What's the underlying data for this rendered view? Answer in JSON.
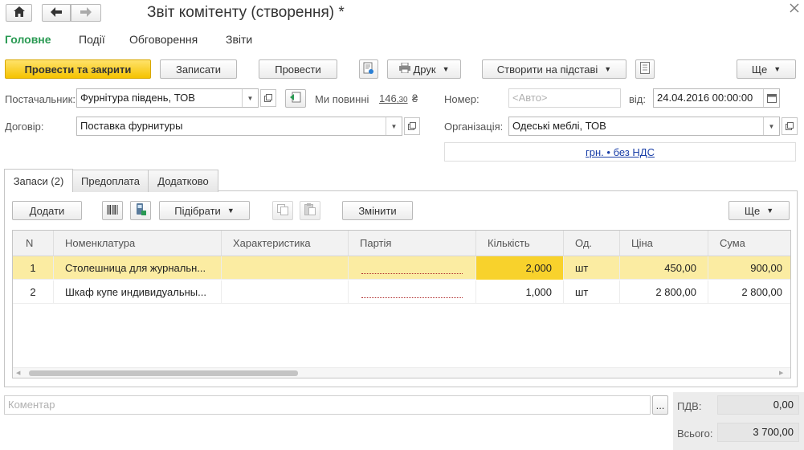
{
  "window": {
    "title": "Звіт комітенту (створення) *",
    "home_icon": "home-icon",
    "back_icon": "arrow-left-icon",
    "forward_icon": "arrow-right-icon",
    "close_icon": "close-icon"
  },
  "topnav": {
    "items": [
      "Головне",
      "Події",
      "Обговорення",
      "Звіти"
    ],
    "active_color": "#2a9a53"
  },
  "toolbar": {
    "post_close": "Провести та закрити",
    "save": "Записати",
    "post": "Провести",
    "print": "Друк",
    "create_based": "Створити на підставі",
    "more": "Ще"
  },
  "form": {
    "supplier_label": "Постачальник:",
    "supplier_value": "Фурнітура південь, ТОВ",
    "debt_label": "Ми повинні",
    "debt_int": "146",
    "debt_frac": ",30",
    "debt_currency": "₴",
    "number_label": "Номер:",
    "number_placeholder": "<Авто>",
    "date_label": "від:",
    "date_value": "24.04.2016 00:00:00",
    "contract_label": "Договір:",
    "contract_value": "Поставка фурнитуры",
    "org_label": "Організація:",
    "org_value": "Одеські меблі, ТОВ",
    "currency_link": "грн. • без НДС"
  },
  "tabs": [
    "Запаси (2)",
    "Предоплата",
    "Додатково"
  ],
  "table_toolbar": {
    "add": "Додати",
    "pick": "Підібрати",
    "change": "Змінити",
    "more": "Ще"
  },
  "table": {
    "columns": [
      "N",
      "Номенклатура",
      "Характеристика",
      "Партія",
      "Кількість",
      "Од.",
      "Ціна",
      "Сума"
    ],
    "rows": [
      {
        "n": "1",
        "item": "Столешница для журнальн...",
        "characteristic": "",
        "batch": "",
        "qty": "2,000",
        "unit": "шт",
        "price": "450,00",
        "sum": "900,00"
      },
      {
        "n": "2",
        "item": "Шкаф купе индивидуальны...",
        "characteristic": "",
        "batch": "",
        "qty": "1,000",
        "unit": "шт",
        "price": "2 800,00",
        "sum": "2 800,00"
      }
    ],
    "selected_row_color": "#fbeca2",
    "selected_cell_color": "#f8d22c"
  },
  "footer": {
    "comment_placeholder": "Коментар",
    "ellipsis": "...",
    "vat_label": "ПДВ:",
    "vat_value": "0,00",
    "total_label": "Всього:",
    "total_value": "3 700,00"
  }
}
